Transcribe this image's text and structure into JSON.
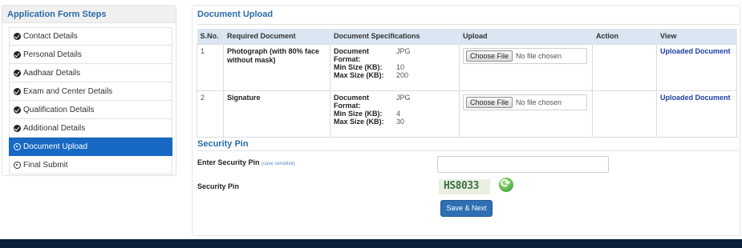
{
  "sidebar": {
    "title": "Application Form Steps",
    "items": [
      {
        "label": "Contact Details"
      },
      {
        "label": "Personal Details"
      },
      {
        "label": "Aadhaar Details"
      },
      {
        "label": "Exam and Center Details"
      },
      {
        "label": "Qualification Details"
      },
      {
        "label": "Additional Details"
      },
      {
        "label": "Document Upload"
      },
      {
        "label": "Final Submit"
      }
    ]
  },
  "documents": {
    "title": "Document Upload",
    "headers": [
      "S.No.",
      "Required Document",
      "Document Specifications",
      "Upload",
      "Action",
      "View"
    ],
    "spec_labels": {
      "format": "Document Format:",
      "min": "Min Size (KB):",
      "max": "Max Size (KB):"
    },
    "rows": [
      {
        "sno": "1",
        "name": "Photograph (with 80% face without mask)",
        "format": "JPG",
        "min": "10",
        "max": "200",
        "choose_file": "Choose File",
        "file_status": "No file chosen",
        "view": "Uploaded Document"
      },
      {
        "sno": "2",
        "name": "Signature",
        "format": "JPG",
        "min": "4",
        "max": "30",
        "choose_file": "Choose File",
        "file_status": "No file chosen",
        "view": "Uploaded Document"
      }
    ]
  },
  "security": {
    "title": "Security Pin",
    "enter_label": "Enter Security Pin",
    "case_note": "(case sensitive)",
    "pin_label": "Security Pin",
    "captcha": "HS8033",
    "input_value": ""
  },
  "actions": {
    "save_next": "Save & Next"
  },
  "colors": {
    "accent": "#1769c4",
    "header": "#2a6ca8",
    "footer": "#0c1f3c",
    "table_header": "#d9e6f2"
  }
}
